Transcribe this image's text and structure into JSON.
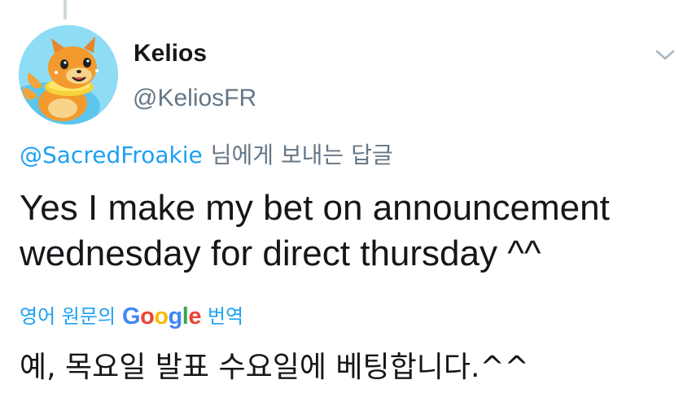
{
  "tweet": {
    "display_name": "Kelios",
    "handle": "@KeliosFR",
    "reply_to_mention": "@SacredFroakie",
    "reply_to_suffix": "님에게 보내는 답글",
    "text": "Yes I make my bet on announcement wednesday for direct thursday ^^",
    "avatar_icon": "buizel-pokemon-avatar",
    "menu_icon": "chevron-down-icon"
  },
  "translation": {
    "prefix": "영어 원문의",
    "google_letters": [
      "G",
      "o",
      "o",
      "g",
      "l",
      "e"
    ],
    "google_colors": [
      "#4285f4",
      "#ea4335",
      "#fbbc05",
      "#4285f4",
      "#34a853",
      "#ea4335"
    ],
    "suffix": "번역",
    "text": "예, 목요일 발표 수요일에 베팅합니다.^^"
  },
  "colors": {
    "link_blue": "#1da1f2",
    "secondary_gray": "#657786",
    "primary_text": "#14171a",
    "thread_line": "#ccd6dd"
  }
}
